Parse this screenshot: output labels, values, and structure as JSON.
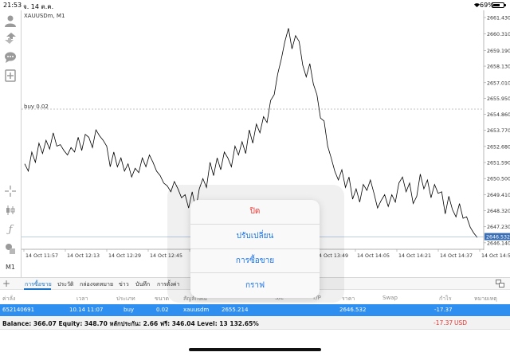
{
  "status_bar": {
    "time": "21:53",
    "date": "จ. 14 ต.ค.",
    "battery": "69%",
    "battery_level": 0.69
  },
  "chart": {
    "symbol_label": "XAUUSDm, M1",
    "order_line_label": "buy 0.02",
    "current_price_label": "2646.532",
    "colors": {
      "line": "#000000",
      "order_line": "#b0b0b0",
      "price_box": "#3a6fb5",
      "grid_text": "#333333"
    }
  },
  "chart_data": {
    "type": "line",
    "title": "XAUUSDm, M1",
    "ylim": [
      2645.7,
      2661.7
    ],
    "y_ticks": [
      "2661.430",
      "2660.310",
      "2659.190",
      "2658.130",
      "2657.010",
      "2655.950",
      "2654.860",
      "2653.770",
      "2652.680",
      "2651.590",
      "2650.500",
      "2649.410",
      "2648.320",
      "2647.230",
      "2646.140"
    ],
    "x_ticks": [
      "14 Oct 11:57",
      "14 Oct 12:13",
      "14 Oct 12:29",
      "14 Oct 12:45",
      "14 Oct 13:01",
      "14 Oct 13:17",
      "14 Oct 13:33",
      "14 Oct 13:49",
      "14 Oct 14:05",
      "14 Oct 14:21",
      "14 Oct 14:37",
      "14 Oct 14:53"
    ],
    "order_price": 2655.214,
    "last_price": 2646.532,
    "series": [
      {
        "values": [
          2651.5,
          2651.0,
          2652.3,
          2651.6,
          2652.9,
          2652.2,
          2653.1,
          2652.5,
          2653.6,
          2652.7,
          2652.8,
          2652.4,
          2652.1,
          2652.6,
          2652.3,
          2653.3,
          2652.4,
          2653.5,
          2653.3,
          2652.6,
          2653.8,
          2653.4,
          2653.1,
          2652.7,
          2651.3,
          2652.3,
          2651.3,
          2651.9,
          2651.0,
          2651.5,
          2650.6,
          2651.2,
          2650.9,
          2651.9,
          2651.3,
          2652.1,
          2651.6,
          2651.0,
          2650.7,
          2650.2,
          2650.0,
          2649.6,
          2650.3,
          2649.8,
          2649.2,
          2649.4,
          2648.5,
          2649.6,
          2648.4,
          2649.8,
          2650.5,
          2649.9,
          2651.6,
          2650.7,
          2651.9,
          2651.1,
          2652.3,
          2651.9,
          2651.3,
          2652.7,
          2652.1,
          2653.0,
          2652.2,
          2653.8,
          2652.9,
          2654.2,
          2653.6,
          2654.7,
          2654.3,
          2655.8,
          2656.2,
          2657.6,
          2658.6,
          2659.8,
          2660.7,
          2659.3,
          2660.2,
          2659.8,
          2658.2,
          2657.4,
          2658.3,
          2656.9,
          2656.2,
          2654.6,
          2654.4,
          2652.7,
          2651.9,
          2651.0,
          2650.4,
          2651.1,
          2649.9,
          2650.6,
          2649.1,
          2649.8,
          2648.9,
          2650.1,
          2649.7,
          2650.4,
          2649.5,
          2648.5,
          2649.0,
          2649.4,
          2648.6,
          2649.4,
          2648.9,
          2650.2,
          2650.6,
          2649.6,
          2650.2,
          2648.8,
          2649.3,
          2650.8,
          2649.8,
          2650.4,
          2649.2,
          2650.1,
          2649.5,
          2649.6,
          2648.1,
          2649.3,
          2648.4,
          2647.9,
          2648.8,
          2647.8,
          2647.9,
          2647.2,
          2646.8,
          2646.5
        ]
      }
    ]
  },
  "tabs": {
    "label": "ค่าลั่ง",
    "items": [
      "การซื้อขาย",
      "ประวัติ",
      "กล่องจดหมาย",
      "ข่าว",
      "บันทึก",
      "การตั้งค่า"
    ]
  },
  "table": {
    "headers": [
      "เวลา",
      "ประเภท",
      "ขนาด",
      "สัญลักษณ์",
      "",
      "S/L",
      "T/P",
      "ราคา",
      "Swap",
      "กำไร",
      "หมายเหตุ"
    ],
    "row": {
      "ticket": "652140691",
      "time": "10.14 11:07",
      "type": "buy",
      "volume": "0.02",
      "symbol": "xauusdm",
      "open_price": "2655.214",
      "price": "2646.532",
      "profit": "-17.37"
    },
    "balance_line": "Balance: 366.07  Equity: 348.70  หลักประกัน: 2.66  ฟรี: 346.04  Level: 13 132.65%",
    "total_profit": "-17.37",
    "currency": "USD"
  },
  "menu": {
    "items": [
      {
        "label": "ปิด",
        "style": "danger"
      },
      {
        "label": "ปรับเปลี่ยน",
        "style": "normal"
      },
      {
        "label": "การซื้อขาย",
        "style": "normal"
      },
      {
        "label": "กราฟ",
        "style": "normal"
      }
    ]
  },
  "left_toolbar": {
    "icons": [
      "person-icon",
      "trade-arrows-icon",
      "chat-icon",
      "add-document-icon",
      "crosshair-icon",
      "candles-icon",
      "function-icon",
      "objects-icon",
      "timeframe-label"
    ],
    "timeframe": "M1"
  }
}
